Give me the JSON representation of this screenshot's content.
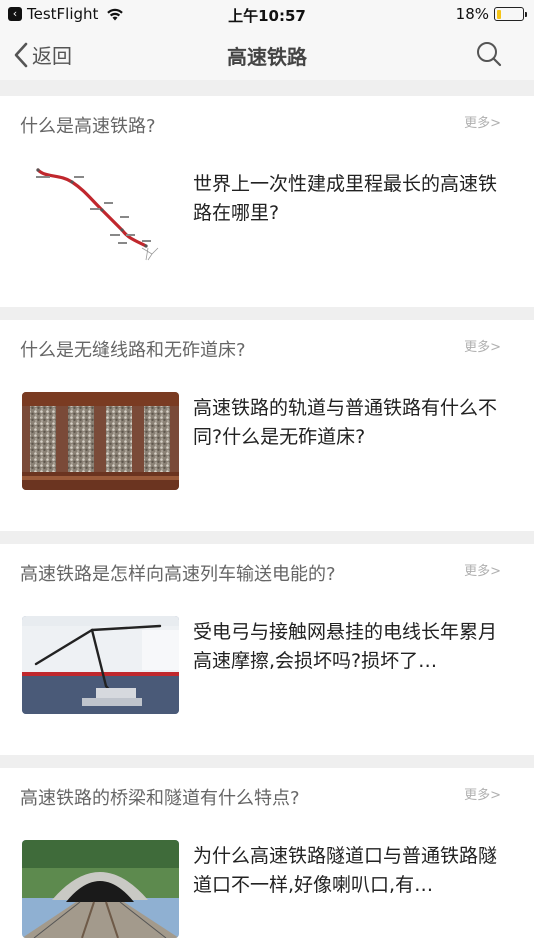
{
  "status_bar": {
    "back_app": "TestFlight",
    "time": "上午10:57",
    "battery": "18%",
    "battery_level": 0.18,
    "battery_color": "#f5c518"
  },
  "nav": {
    "back_label": "返回",
    "title": "高速铁路",
    "search_icon": "search-icon"
  },
  "cards": [
    {
      "topic": "什么是高速铁路?",
      "more": "更多>",
      "question": "世界上一次性建成里程最长的高速铁路在哪里?",
      "image": "rail-map"
    },
    {
      "topic": "什么是无缝线路和无砟道床?",
      "more": "更多>",
      "question": "高速铁路的轨道与普通铁路有什么不同?什么是无砟道床?",
      "image": "rail-ballast-photo"
    },
    {
      "topic": "高速铁路是怎样向高速列车输送电能的?",
      "more": "更多>",
      "question": "受电弓与接触网悬挂的电线长年累月高速摩擦,会损坏吗?损坏了…",
      "image": "pantograph-photo"
    },
    {
      "topic": "高速铁路的桥梁和隧道有什么特点?",
      "more": "更多>",
      "question": "为什么高速铁路隧道口与普通铁路隧道口不一样,好像喇叭口,有…",
      "image": "tunnel-photo"
    }
  ]
}
